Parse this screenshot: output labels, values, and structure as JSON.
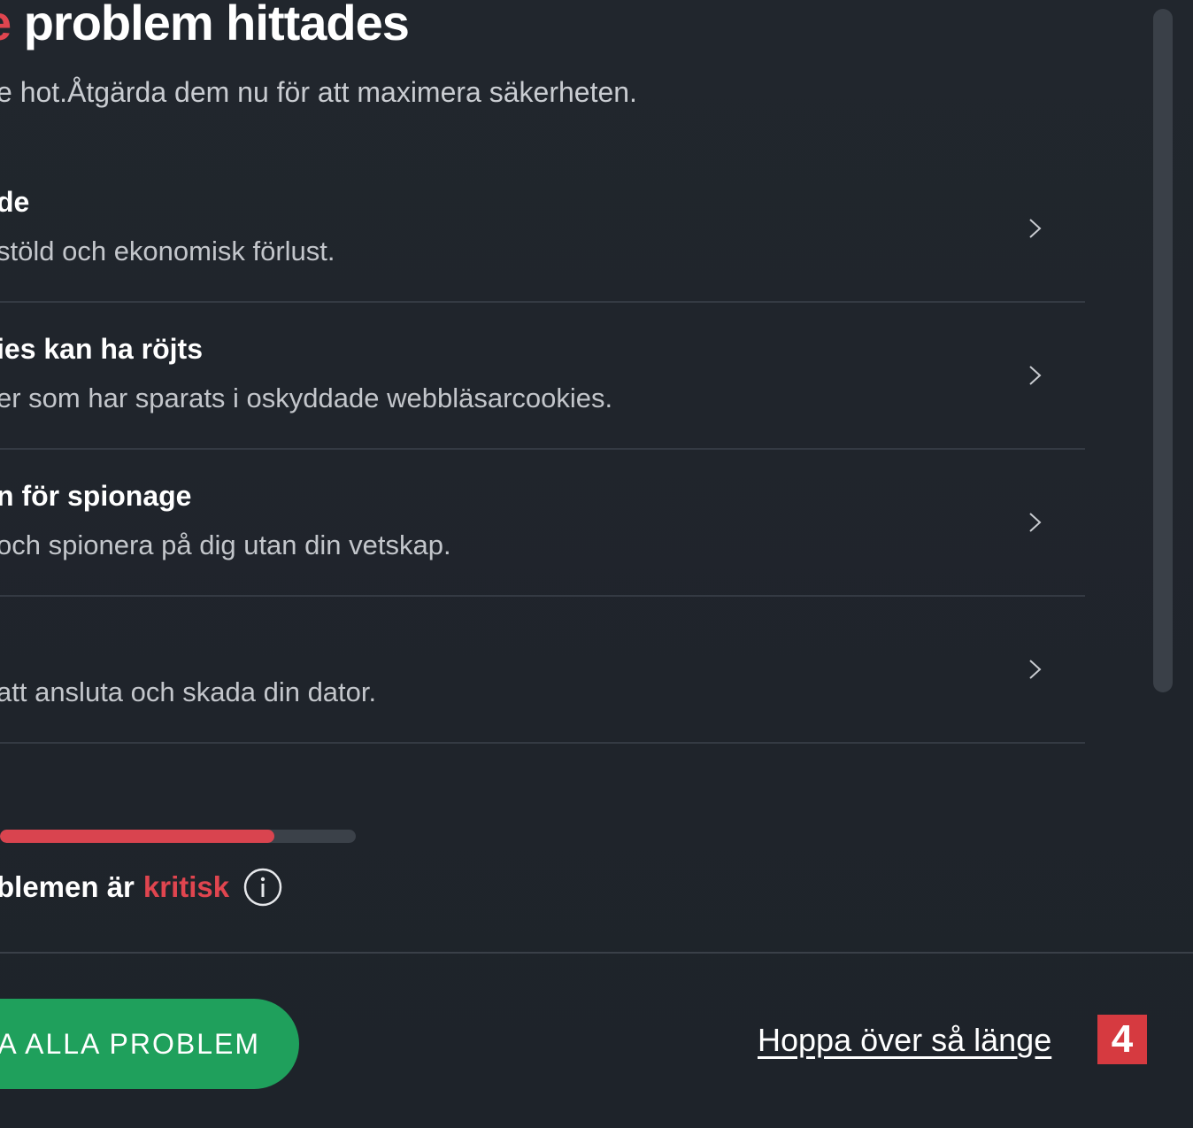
{
  "header": {
    "title_accent": "e",
    "title_rest": " problem hittades",
    "subtitle": "e hot.Åtgärda dem nu för att maximera säkerheten."
  },
  "issues": [
    {
      "title": "de",
      "description": "stöld och ekonomisk förlust."
    },
    {
      "title": "ies kan ha röjts",
      "description": "er som har sparats i oskyddade webbläsarcookies."
    },
    {
      "title": "n för spionage",
      "description": " och spionera på dig utan din vetskap."
    },
    {
      "title": "",
      "description": " att ansluta och skada din dator."
    }
  ],
  "severity": {
    "progress_fraction": 0.77,
    "text": "blemen är",
    "level": "kritisk"
  },
  "footer": {
    "fix_button_label": "A ALLA PROBLEM",
    "skip_link_label": "Hoppa över så länge",
    "badge_number": "4"
  },
  "icons": {
    "chevron": "chevron-right-icon",
    "info": "info-icon"
  },
  "colors": {
    "background": "#1f242b",
    "accent_red": "#e0454f",
    "button_green": "#1fa05c",
    "badge_red": "#d63a40"
  }
}
